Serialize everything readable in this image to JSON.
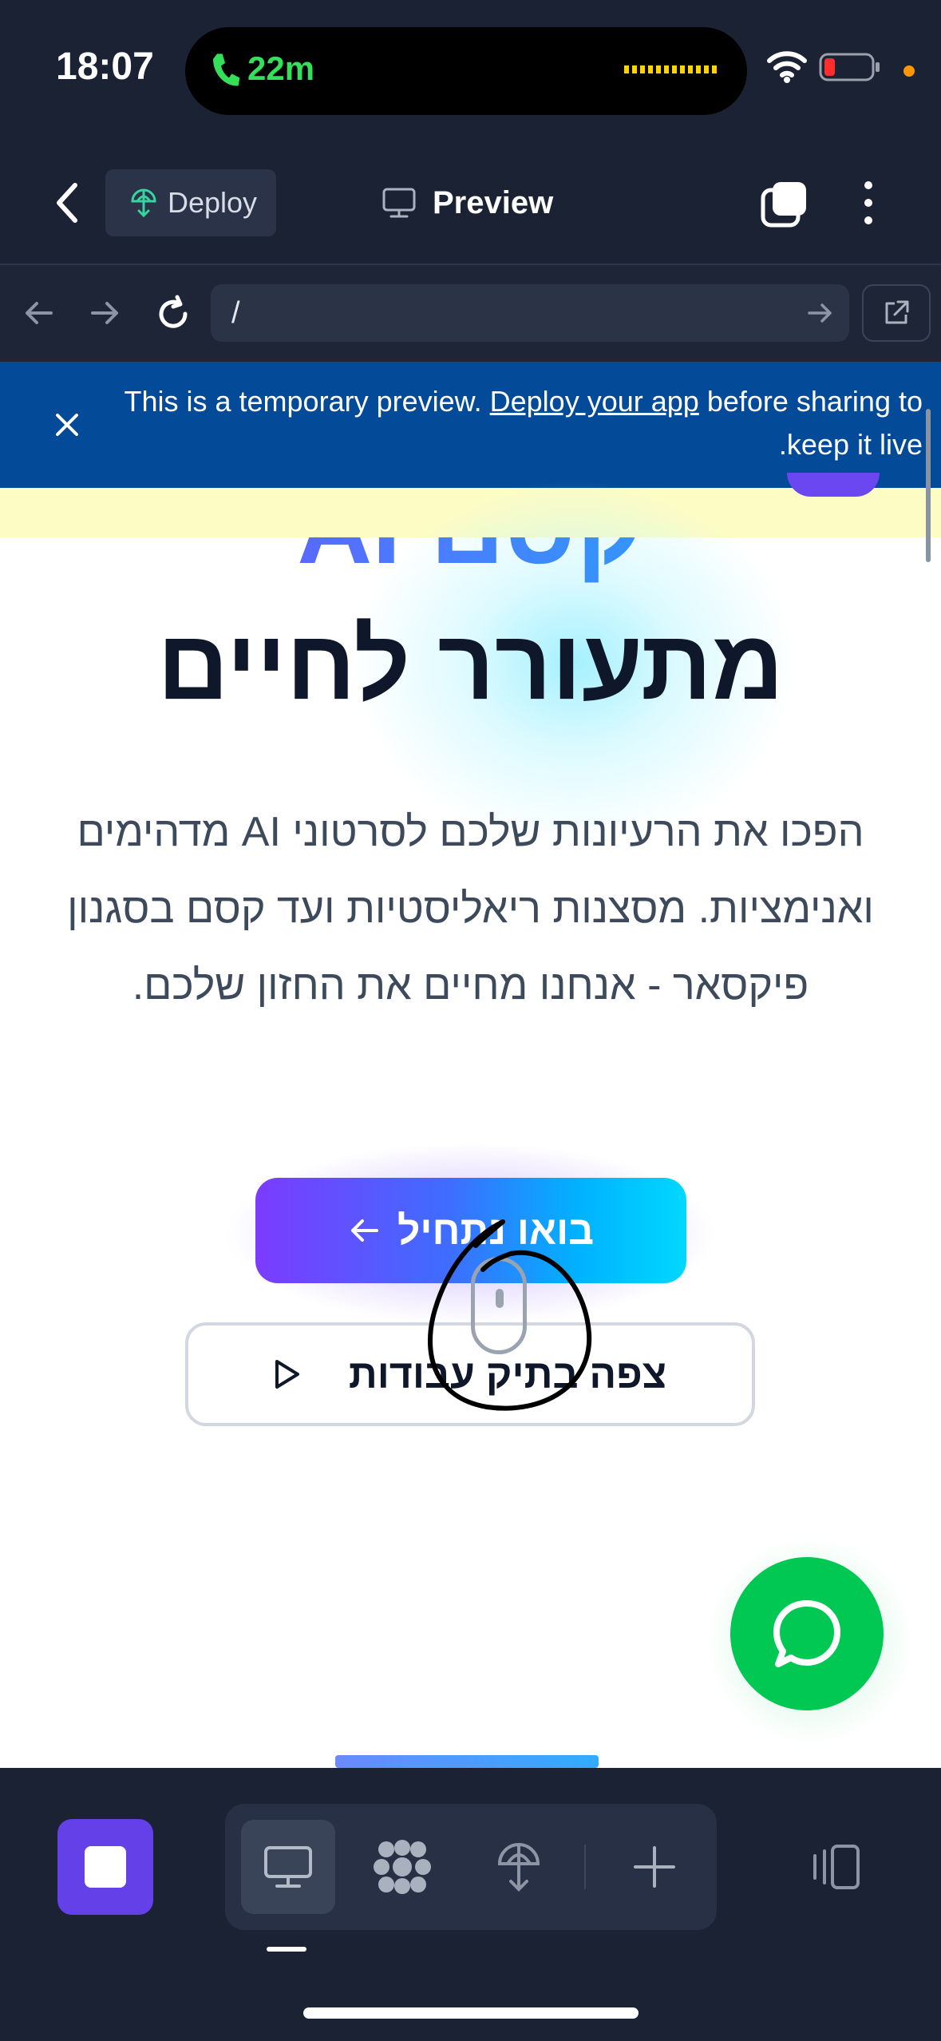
{
  "status_bar": {
    "time": "18:07",
    "call_duration": "22m"
  },
  "app_header": {
    "deploy_label": "Deploy",
    "preview_label": "Preview"
  },
  "url_bar": {
    "path": "/"
  },
  "banner": {
    "text_before": "This is a temporary preview. ",
    "link_text": "Deploy your app",
    "text_after": " before sharing to keep it live."
  },
  "hero": {
    "title_line1": "קסם AI",
    "title_line2": "מתעורר לחיים",
    "description": "הפכו את הרעיונות שלכם לסרטוני AI מדהימים ואנימציות. מסצנות ריאליסטיות ועד קסם בסגנון פיקסאר - אנחנו מחיים את החזון שלכם."
  },
  "cta": {
    "primary_label": "בואו נתחיל",
    "secondary_label": "צפה בתיק עבודות"
  },
  "colors": {
    "accent_purple": "#6340e8",
    "whatsapp_green": "#00c853",
    "chrome_bg": "#1b2233",
    "banner_blue": "#034a99"
  },
  "icons": {
    "status": [
      "phone-icon",
      "wifi-icon",
      "battery-icon"
    ],
    "header": [
      "chevron-left-icon",
      "deploy-icon",
      "monitor-icon",
      "tabs-icon",
      "kebab-icon"
    ],
    "browser": [
      "arrow-left-icon",
      "arrow-right-icon",
      "reload-icon",
      "arrow-right-icon",
      "external-link-icon"
    ],
    "toolbar": [
      "stop-icon",
      "monitor-icon",
      "agents-icon",
      "deploy-icon",
      "plus-icon",
      "layout-toggle-icon"
    ],
    "content": [
      "arrow-left-icon",
      "play-icon",
      "whatsapp-icon",
      "mouse-scroll-icon"
    ]
  }
}
